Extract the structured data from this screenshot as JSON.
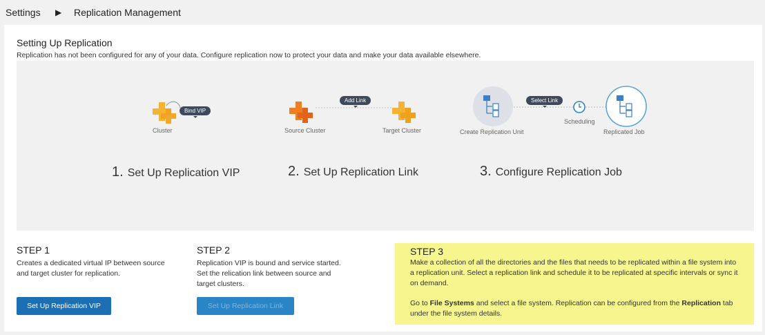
{
  "breadcrumb": {
    "root": "Settings",
    "separator": "▶",
    "current": "Replication Management"
  },
  "header": {
    "title": "Setting Up Replication",
    "subtitle": "Replication has not been configured for any of your data. Configure replication now to protect your data and make your data available elsewhere."
  },
  "diagram": {
    "step1": {
      "pill": "Bind VIP",
      "caption": "Cluster",
      "number": "1.",
      "label": "Set Up Replication VIP"
    },
    "step2": {
      "pill": "Add Link",
      "source": "Source Cluster",
      "target": "Target Cluster",
      "number": "2.",
      "label": "Set Up Replication Link"
    },
    "step3": {
      "pill": "Select Link",
      "unit": "Create Replication Unit",
      "scheduling": "Scheduling",
      "job": "Replicated Job",
      "number": "3.",
      "label": "Configure Replication Job"
    }
  },
  "steps": [
    {
      "heading": "STEP 1",
      "text": "Creates a dedicated virtual IP between source and target cluster for replication.",
      "button": "Set Up Replication VIP"
    },
    {
      "heading": "STEP 2",
      "text": "Replication VIP is bound and service started. Set the relication link between source and target clusters.",
      "button": "Set Up Replication Link"
    },
    {
      "heading": "STEP 3",
      "text": "Make a collection of all the directories and the files that needs to be replicated within a file system into a replication unit. Select a replication link and schedule it to be replicated at specific intervals or sync it on demand.",
      "note_prefix": "Go to ",
      "note_bold1": "File Systems",
      "note_mid": " and select a file system. Replication can be configured from the ",
      "note_bold2": "Replication",
      "note_suffix": " tab under the file system details."
    }
  ],
  "colors": {
    "cluster": "#f5b335",
    "source_cluster": "#ef7d22",
    "primary_button": "#1d6fb3",
    "highlight": "#f7f68e"
  }
}
